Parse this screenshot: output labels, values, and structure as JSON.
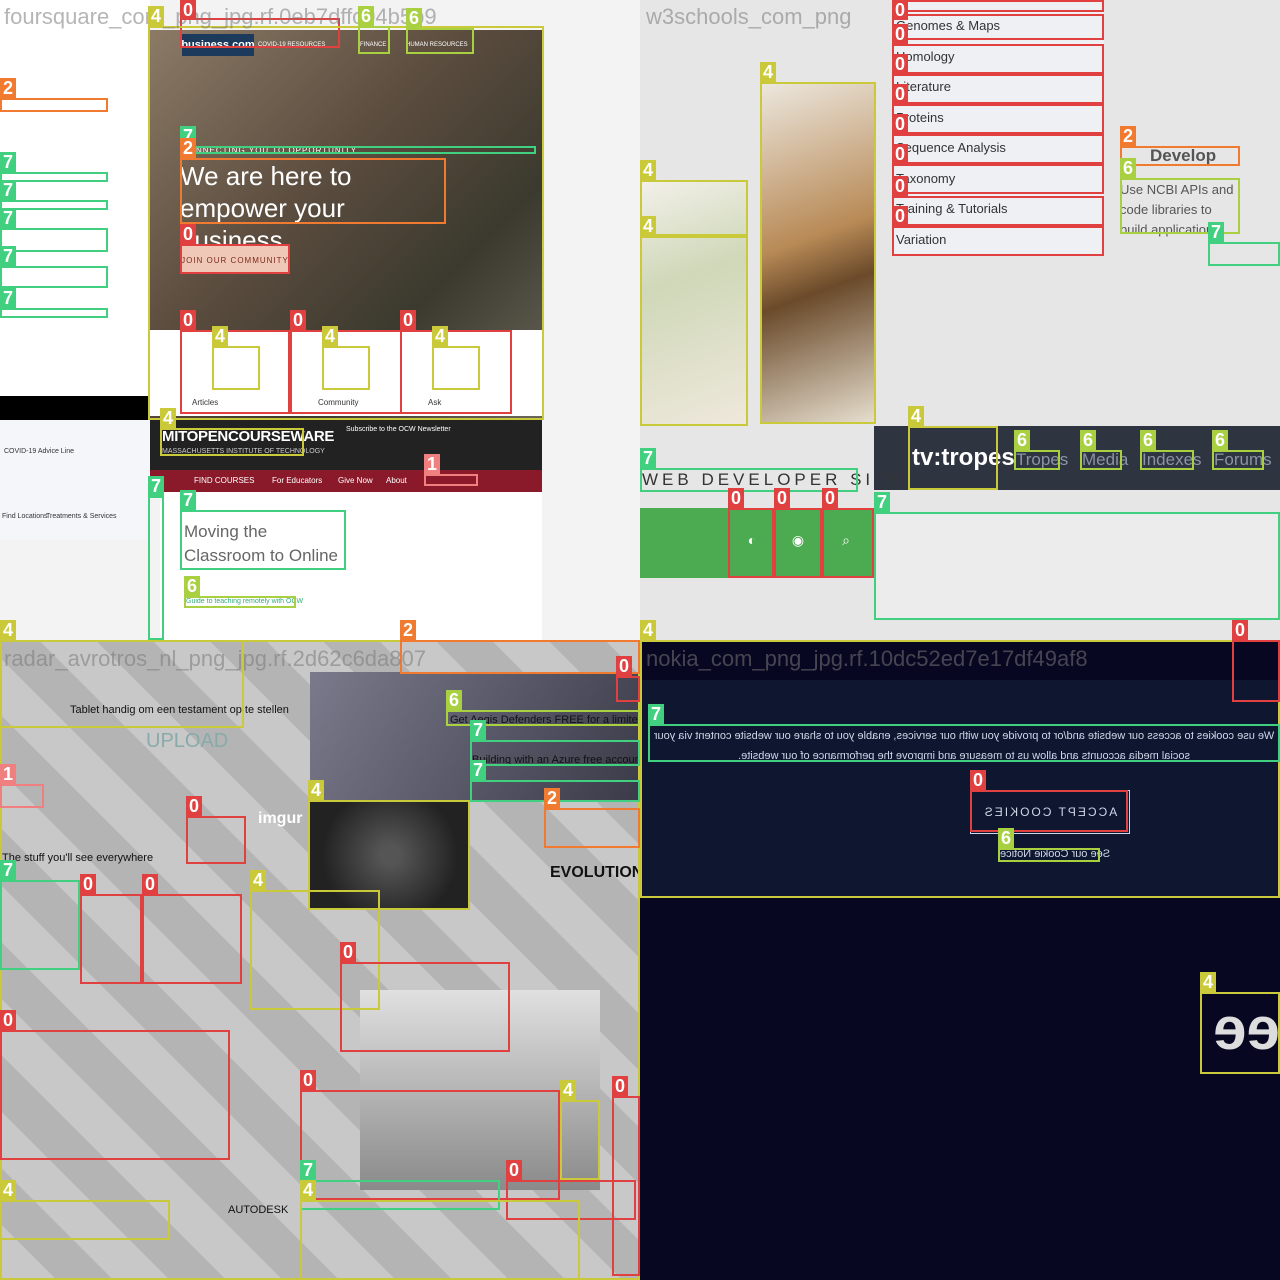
{
  "quadrants": {
    "q1": {
      "title": "foursquare_com_png_jpg.rf.0eb7dffc04b5b9"
    },
    "q2": {
      "title": "w3schools_com_png"
    },
    "q3": {
      "title": "radar_avrotros_nl_png_jpg.rf.2d62c6da807"
    },
    "q4": {
      "title": "nokia_com_png_jpg.rf.10dc52ed7e17df49af8"
    }
  },
  "business": {
    "brand": "business.com",
    "nav": [
      "COVID-19 RESOURCES",
      "FINANCE",
      "HUMAN RESOURCES"
    ],
    "kicker": "CONNECTING YOU TO OPPORTUNITY",
    "headline": "We are here to empower your business.",
    "cta": "JOIN OUR COMMUNITY",
    "cards": [
      "Articles",
      "Community",
      "Ask"
    ],
    "newsletter": "Subscribe to the OCW Newsletter"
  },
  "mit": {
    "logo": "MITOPENCOURSEWARE",
    "sub": "MASSACHUSETTS INSTITUTE OF TECHNOLOGY",
    "nav": [
      "FIND COURSES",
      "For Educators",
      "Give Now",
      "About"
    ],
    "heading": "Moving the Classroom to Online",
    "link": "Guide to teaching remotely with OCW"
  },
  "leftpanel": {
    "items": [
      "COVID-19 Advice Line",
      "Find Locations",
      "Treatments & Services"
    ]
  },
  "w3": {
    "menu": [
      "Genomes & Maps",
      "Homology",
      "Literature",
      "Proteins",
      "Sequence Analysis",
      "Taxonomy",
      "Training & Tutorials",
      "Variation"
    ],
    "develop_title": "Develop",
    "develop_text": "Use NCBI APIs and code libraries to build applications",
    "wds": "WEB DEVELOPER SITE"
  },
  "tvtropes": {
    "logo": "tv:tropes",
    "links": [
      "Tropes",
      "Media",
      "Indexes",
      "Forums"
    ]
  },
  "radar": {
    "upload": "UPLOAD",
    "texts": [
      "Tablet handig om een testament op te stellen",
      "The stuff you'll see everywhere",
      "Get Aegis Defenders FREE for a limited time",
      "Building with an Azure free account",
      "EVOLUTION",
      "imgur",
      "AUTODESK"
    ]
  },
  "nokia": {
    "cookie_text": "We use cookies to access our website and/or to provide you with our services, enable you to share our website content via your social media accounts and allow us to measure and improve the performance of our website.",
    "accept": "ACCEPT COOKIES",
    "notice": "See our Cookie Notice",
    "logo": "ee"
  }
}
